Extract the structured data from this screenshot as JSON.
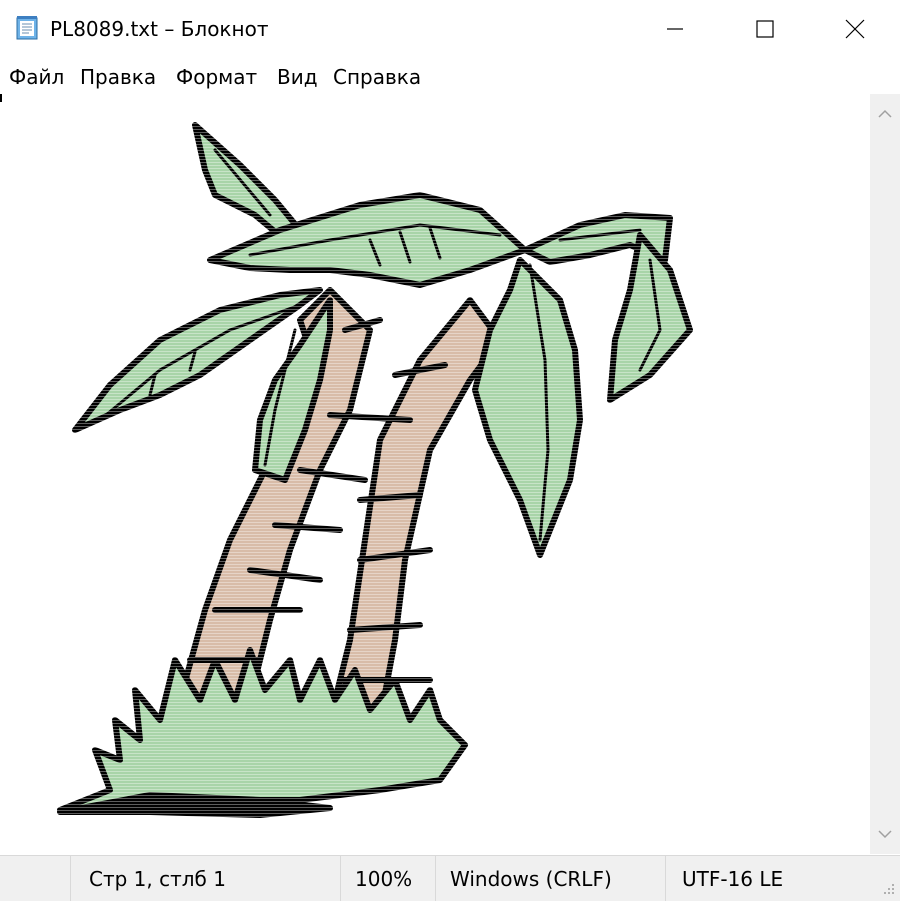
{
  "window": {
    "title": "PL8089.txt – Блокнот"
  },
  "menu": {
    "items": [
      "Файл",
      "Правка",
      "Формат",
      "Вид",
      "Справка"
    ]
  },
  "editor": {
    "content_image": "palm-trees-ascii-art"
  },
  "status": {
    "position": "Стр 1, стлб 1",
    "zoom": "100%",
    "line_endings": "Windows (CRLF)",
    "encoding": "UTF-16 LE"
  },
  "colors": {
    "leaf": "#a8d4a8",
    "trunk": "#d8bca8",
    "outline": "#000000",
    "status_bg": "#f0f0f0"
  }
}
